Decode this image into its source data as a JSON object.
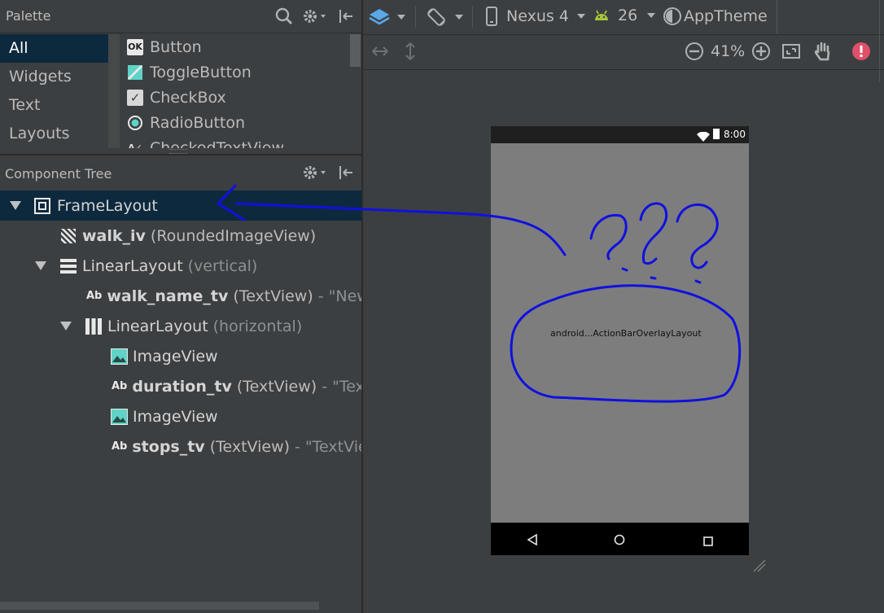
{
  "palette": {
    "title": "Palette",
    "categories": [
      {
        "label": "All",
        "selected": true
      },
      {
        "label": "Widgets",
        "selected": false
      },
      {
        "label": "Text",
        "selected": false
      },
      {
        "label": "Layouts",
        "selected": false
      }
    ],
    "items": [
      {
        "label": "Button",
        "icon": "ok-button-icon",
        "glyph": "OK"
      },
      {
        "label": "ToggleButton",
        "icon": "toggle-icon",
        "glyph": ""
      },
      {
        "label": "CheckBox",
        "icon": "checkbox-icon",
        "glyph": "✓"
      },
      {
        "label": "RadioButton",
        "icon": "radio-icon",
        "glyph": ""
      },
      {
        "label": "CheckedTextView",
        "icon": "checked-text-icon",
        "glyph": "A✓"
      }
    ]
  },
  "component_tree": {
    "title": "Component Tree",
    "rows": [
      {
        "name": "FrameLayout",
        "type": "",
        "detail": ""
      },
      {
        "name": "walk_iv",
        "type": "(RoundedImageView)",
        "detail": ""
      },
      {
        "name": "LinearLayout",
        "type": "(vertical)",
        "detail": ""
      },
      {
        "name": "walk_name_tv",
        "type": "(TextView)",
        "detail": "- \"New Te"
      },
      {
        "name": "LinearLayout",
        "type": "(horizontal)",
        "detail": ""
      },
      {
        "name": "ImageView",
        "type": "",
        "detail": ""
      },
      {
        "name": "duration_tv",
        "type": "(TextView)",
        "detail": "- \"TextVi"
      },
      {
        "name": "ImageView",
        "type": "",
        "detail": ""
      },
      {
        "name": "stops_tv",
        "type": "(TextView)",
        "detail": "- \"TextView\""
      }
    ]
  },
  "toolbar": {
    "device": "Nexus 4",
    "api": "26",
    "theme": "AppTheme",
    "zoom": "41%"
  },
  "preview": {
    "time": "8:00",
    "label": "android...ActionBarOverlayLayout"
  },
  "colors": {
    "panel": "#3c3f41",
    "selection": "#0d293e",
    "annotation": "#1010e0",
    "accent_teal": "#5fd3c7",
    "error": "#e0506a"
  }
}
